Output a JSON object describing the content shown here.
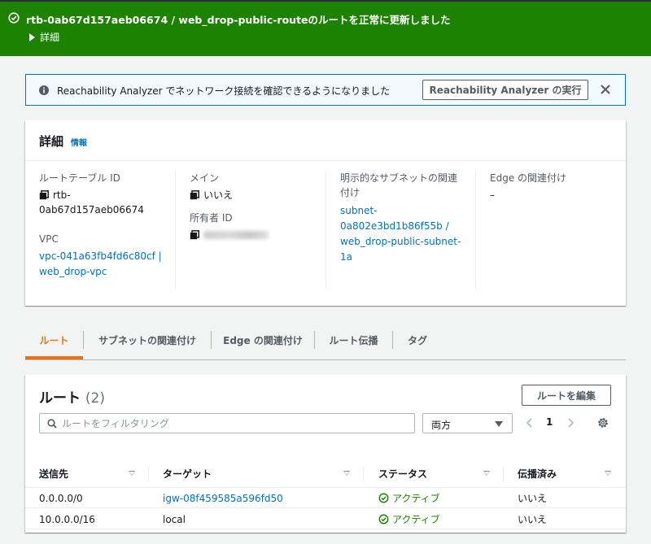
{
  "flash": {
    "message": "rtb-0ab67d157aeb06674 / web_drop-public-routeのルートを正常に更新しました",
    "details_toggle": "詳細",
    "color": "#1d8102"
  },
  "info_banner": {
    "message": "Reachability Analyzer でネットワーク接続を確認できるようになりました",
    "button_label": "Reachability Analyzer の実行"
  },
  "details": {
    "title": "詳細",
    "info_link": "情報",
    "route_table_id_label": "ルートテーブル ID",
    "route_table_id_line1": "rtb-",
    "route_table_id_line2": "0ab67d157aeb06674",
    "vpc_label": "VPC",
    "vpc_line1": "vpc-041a63fb4fd6c80cf |",
    "vpc_line2": "web_drop-vpc",
    "main_label": "メイン",
    "main_value": "いいえ",
    "owner_label": "所有者 ID",
    "subnet_assoc_label_line1": "明示的なサブネットの関連",
    "subnet_assoc_label_line2": "付け",
    "subnet_line1": "subnet-",
    "subnet_line2": "0a802e3bd1b86f55b /",
    "subnet_line3": "web_drop-public-subnet-",
    "subnet_line4": "1a",
    "edge_label": "Edge の関連付け",
    "edge_value": "–"
  },
  "tabs": [
    {
      "label": "ルート",
      "active": true
    },
    {
      "label": "サブネットの関連付け",
      "active": false
    },
    {
      "label": "Edge の関連付け",
      "active": false
    },
    {
      "label": "ルート伝播",
      "active": false
    },
    {
      "label": "タグ",
      "active": false
    }
  ],
  "routes": {
    "title": "ルート",
    "count": "(2)",
    "edit_button": "ルートを編集",
    "search_placeholder": "ルートをフィルタリング",
    "filter_select": "両方",
    "page": "1",
    "columns": [
      "送信先",
      "ターゲット",
      "ステータス",
      "伝播済み"
    ],
    "rows": [
      {
        "destination": "0.0.0.0/0",
        "target": "igw-08f459585a596fd50",
        "target_is_link": true,
        "status": "アクティブ",
        "propagated": "いいえ"
      },
      {
        "destination": "10.0.0.0/16",
        "target": "local",
        "target_is_link": false,
        "status": "アクティブ",
        "propagated": "いいえ"
      }
    ]
  },
  "colors": {
    "accent": "#ec7211",
    "link": "#0073bb",
    "success": "#1d8102"
  }
}
